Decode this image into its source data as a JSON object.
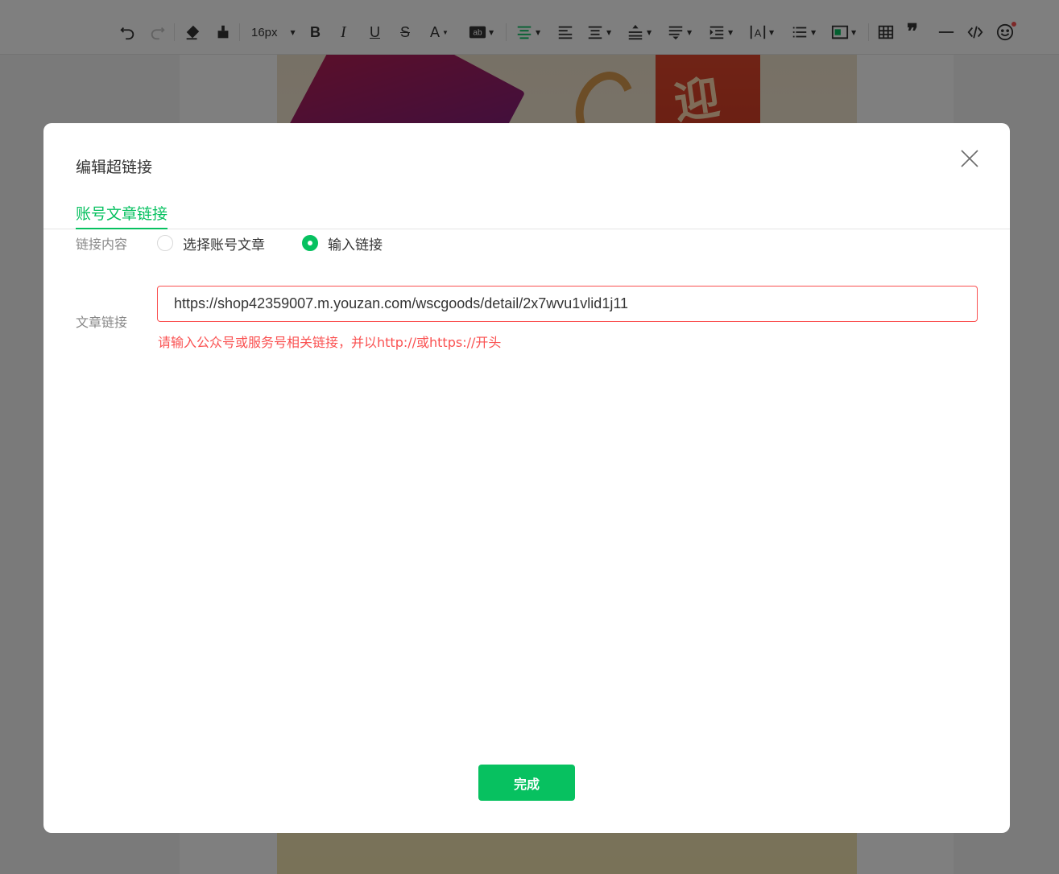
{
  "toolbar": {
    "font_size": "16px",
    "items": [
      "undo-icon",
      "redo-icon",
      "clear-format-icon",
      "format-painter-icon",
      "font-size-select",
      "bold-icon",
      "italic-icon",
      "underline-icon",
      "strikethrough-icon",
      "font-color-icon",
      "background-color-icon",
      "align-center-icon",
      "indent-icon",
      "justify-icon",
      "line-height-icon",
      "paragraph-spacing-icon",
      "text-indent-icon",
      "letter-spacing-icon",
      "list-icon",
      "border-color-icon",
      "table-icon",
      "quote-icon",
      "divider-icon",
      "code-icon",
      "emoji-icon"
    ],
    "accent_color": "#07c160"
  },
  "banner": {
    "text": "迎新"
  },
  "dialog": {
    "title": "编辑超链接",
    "tab_label": "账号文章链接",
    "content_label": "链接内容",
    "options": [
      {
        "label": "选择账号文章",
        "checked": false
      },
      {
        "label": "输入链接",
        "checked": true
      }
    ],
    "link_label": "文章链接",
    "link_value": "https://shop42359007.m.youzan.com/wscgoods/detail/2x7wvu1vlid1j11",
    "error_text": "请输入公众号或服务号相关链接，并以http://或https://开头",
    "done_label": "完成",
    "error_color": "#fa5151",
    "primary_color": "#07c160"
  }
}
